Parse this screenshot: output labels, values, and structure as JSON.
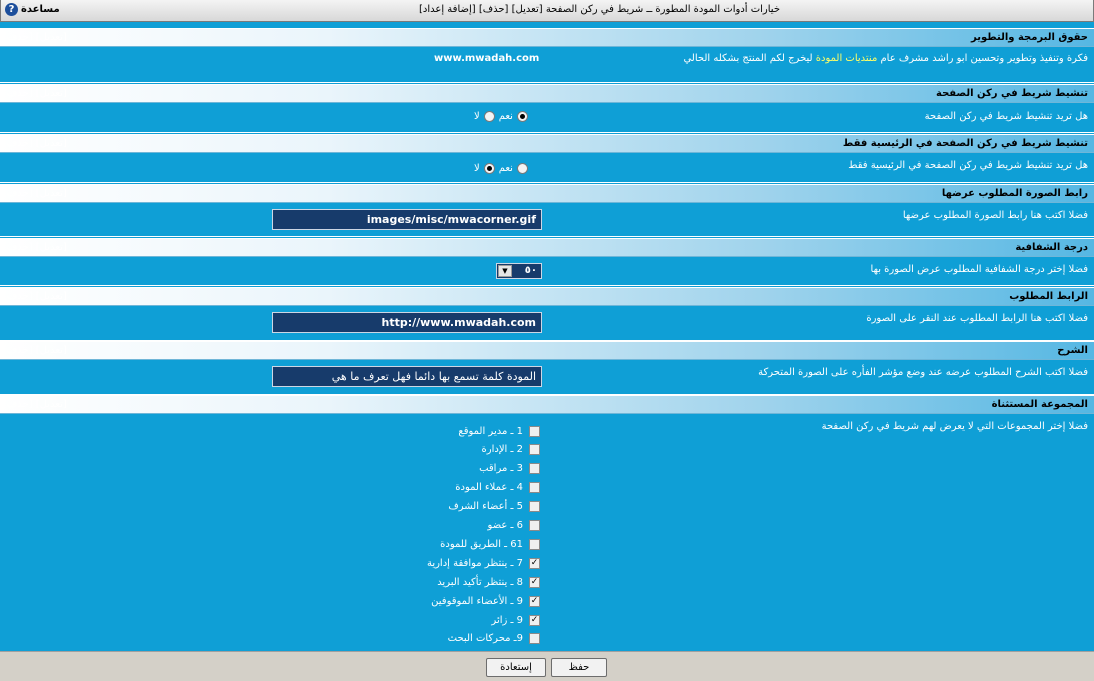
{
  "window": {
    "title": "خيارات أدوات المودة المطورة ــ شريط في ركن الصفحة [تعديل] [حذف] [إضافة إعداد]",
    "help_label": "مساعدة"
  },
  "section_links": "[تعديل] [حذف]",
  "sections": [
    {
      "title": "حقوق البرمجة والتطوير",
      "desc_before": "فكرة وتنفيذ وتطوير وتحسين ابو راشد مشرف عام ",
      "desc_highlight": "منتديات المودة",
      "desc_after": " ليخرج لكم المنتج بشكله الحالي",
      "value": "www.mwadah.com"
    },
    {
      "title": "تنشيط شريط في ركن الصفحة",
      "desc": "هل تريد تنشيط شريط في ركن الصفحة",
      "yes": "نعم",
      "no": "لا",
      "selected": "yes"
    },
    {
      "title": "تنشيط شريط في ركن الصفحة في الرئيسية فقط",
      "desc": "هل تريد تنشيط شريط في ركن الصفحة في الرئيسية فقط",
      "yes": "نعم",
      "no": "لا",
      "selected": "no"
    },
    {
      "title": "رابط الصورة المطلوب عرضها",
      "desc": "فضلا اكتب هنا رابط الصورة المطلوب عرضها",
      "value": "images/misc/mwacorner.gif"
    },
    {
      "title": "درجة الشفافية",
      "desc": "فضلا إختر درجة الشفافية المطلوب عرض الصورة بها",
      "value": "٥٠"
    },
    {
      "title": "الرابط المطلوب",
      "desc": "فضلا اكتب هنا الرابط المطلوب عند النقر على الصورة",
      "value": "http://www.mwadah.com"
    },
    {
      "title": "الشرح",
      "desc": "فضلا اكتب الشرح المطلوب عرضه عند وضع مؤشر الفأره على الصورة المتحركة",
      "value": "المودة كلمة تسمع بها دائما فهل تعرف ما هي"
    },
    {
      "title": "المجموعة المستثناة",
      "desc": "فضلا إختر المجموعات التي لا يعرض لهم شريط في ركن الصفحة"
    }
  ],
  "groups": [
    {
      "label": "1 ـ مدير الموقع",
      "checked": false
    },
    {
      "label": "2 ـ الإدارة",
      "checked": false
    },
    {
      "label": "3 ـ مراقب",
      "checked": false
    },
    {
      "label": "4 ـ عملاء المودة",
      "checked": false
    },
    {
      "label": "5 ـ أعضاء الشرف",
      "checked": false
    },
    {
      "label": "6 ـ عضو",
      "checked": false
    },
    {
      "label": "61 ـ الطريق للمودة",
      "checked": false
    },
    {
      "label": "7 ـ ينتظر موافقة إدارية",
      "checked": true
    },
    {
      "label": "8 ـ ينتظر تأكيد البريد",
      "checked": true
    },
    {
      "label": "9 ـ الأعضاء الموقوفين",
      "checked": true
    },
    {
      "label": "9 ـ زائر",
      "checked": true
    },
    {
      "label": "9ـ محركات البحث",
      "checked": false
    }
  ],
  "footer": {
    "save_label": "حفظ",
    "reset_label": "إستعادة"
  },
  "colors": {
    "background": "#0f9fd6",
    "input_bg": "#173b6b",
    "highlight": "#ffff66"
  }
}
